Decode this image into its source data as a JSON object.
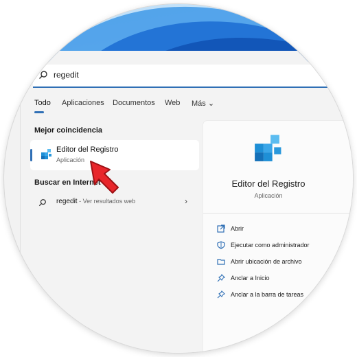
{
  "search": {
    "query": "regedit"
  },
  "tabs": [
    {
      "label": "Todo"
    },
    {
      "label": "Aplicaciones"
    },
    {
      "label": "Documentos"
    },
    {
      "label": "Web"
    },
    {
      "label": "Más"
    }
  ],
  "best_match": {
    "title": "Mejor coincidencia",
    "name": "Editor del Registro",
    "type": "Aplicación",
    "icon": "registry-editor-icon"
  },
  "web_search": {
    "title": "Buscar en Internet",
    "query": "regedit",
    "suffix": " - Ver resultados web"
  },
  "details": {
    "name": "Editor del Registro",
    "type": "Aplicación",
    "actions": [
      {
        "label": "Abrir",
        "icon": "open-icon"
      },
      {
        "label": "Ejecutar como administrador",
        "icon": "shield-icon"
      },
      {
        "label": "Abrir ubicación de archivo",
        "icon": "folder-icon"
      },
      {
        "label": "Anclar a Inicio",
        "icon": "pin-icon"
      },
      {
        "label": "Anclar a la barra de tareas",
        "icon": "pin-icon"
      }
    ]
  },
  "colors": {
    "accent": "#2f6fb5",
    "arrow": "#e8262b",
    "icon_blue": "#1e8fd6"
  }
}
